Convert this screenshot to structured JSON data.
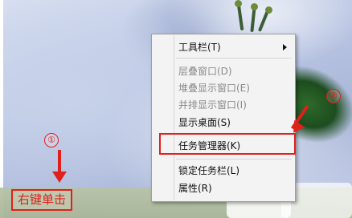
{
  "context_menu": {
    "items": [
      {
        "label": "工具栏(T)",
        "enabled": true,
        "has_submenu": true
      },
      {
        "label": "层叠窗口(D)",
        "enabled": false
      },
      {
        "label": "堆叠显示窗口(E)",
        "enabled": false
      },
      {
        "label": "并排显示窗口(I)",
        "enabled": false
      },
      {
        "label": "显示桌面(S)",
        "enabled": true
      },
      {
        "label": "任务管理器(K)",
        "enabled": true
      },
      {
        "label": "锁定任务栏(L)",
        "enabled": true
      },
      {
        "label": "属性(R)",
        "enabled": true
      }
    ]
  },
  "annotations": {
    "step1_number": "①",
    "step2_number": "②",
    "click_label": "右键单击",
    "color": "#e0201b"
  }
}
